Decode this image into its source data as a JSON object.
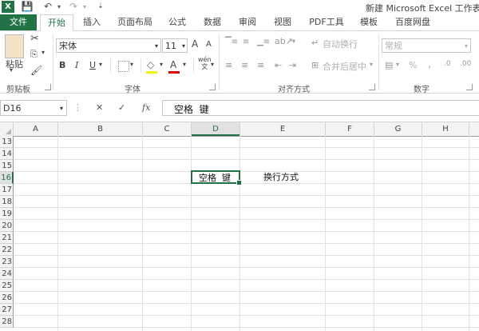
{
  "window": {
    "title": "新建 Microsoft Excel 工作表"
  },
  "quick_access": {
    "app": "X",
    "save": "💾",
    "undo": "↶",
    "redo": "↷"
  },
  "tabs": [
    "文件",
    "开始",
    "插入",
    "页面布局",
    "公式",
    "数据",
    "审阅",
    "视图",
    "PDF工具",
    "模板",
    "百度网盘"
  ],
  "ribbon": {
    "clipboard": {
      "label": "剪贴板",
      "paste": "粘贴"
    },
    "font": {
      "label": "字体",
      "name": "宋体",
      "size": "11",
      "grow": "A",
      "shrink": "A",
      "bold": "B",
      "italic": "I",
      "underline": "U",
      "font_color": "A",
      "wen": "wén",
      "wen_char": "文"
    },
    "alignment": {
      "label": "对齐方式",
      "wrap": "自动换行",
      "merge": "合并后居中"
    },
    "number": {
      "label": "数字",
      "format": "常规",
      "percent": "%",
      "comma": ","
    }
  },
  "formula_bar": {
    "name_box": "D16",
    "cancel": "✕",
    "enter": "✓",
    "fx": "fx",
    "content": "空格  键"
  },
  "columns": [
    "A",
    "B",
    "C",
    "D",
    "E",
    "F",
    "G",
    "H"
  ],
  "active_column": "D",
  "rows": [
    "13",
    "14",
    "15",
    "16",
    "17",
    "18",
    "19",
    "20",
    "21",
    "22",
    "23",
    "24",
    "25",
    "26",
    "27",
    "28"
  ],
  "active_row": "16",
  "cells": {
    "D16": "空格  键",
    "E16": "换行方式"
  },
  "colors": {
    "accent": "#217346",
    "grid": "#e1e1e1",
    "header_bg": "#f3f3f3"
  }
}
